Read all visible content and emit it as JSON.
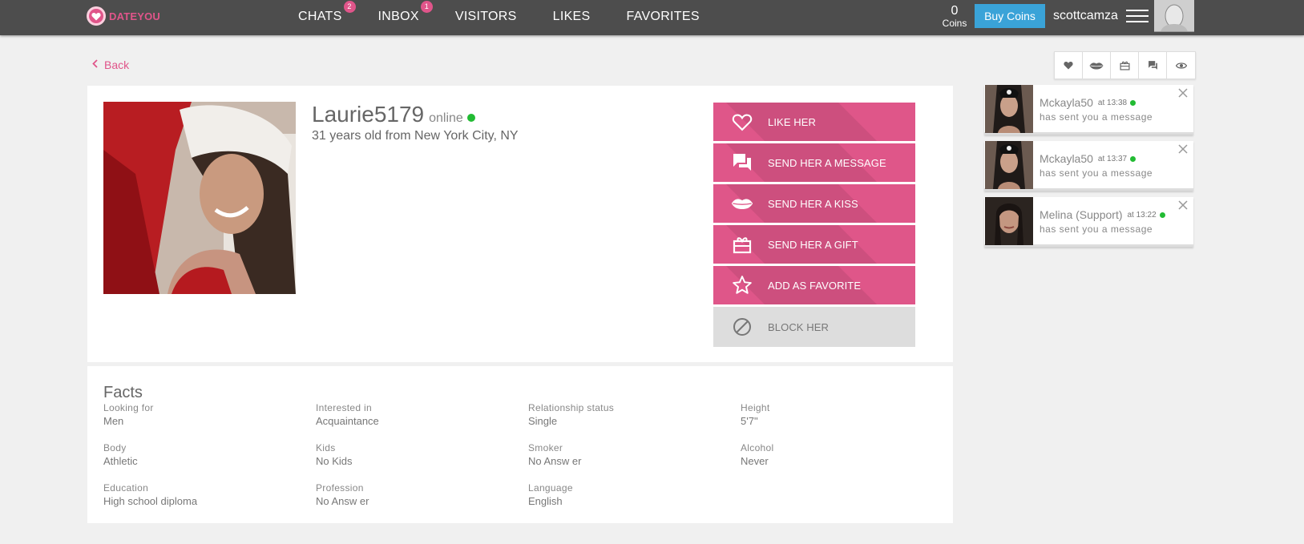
{
  "brand": {
    "name": "DATEYOU",
    "accent": "#e0558a"
  },
  "nav": {
    "items": [
      {
        "label": "CHATS",
        "badge": "2"
      },
      {
        "label": "INBOX",
        "badge": "1"
      },
      {
        "label": "VISITORS",
        "badge": ""
      },
      {
        "label": "LIKES",
        "badge": ""
      },
      {
        "label": "FAVORITES",
        "badge": ""
      }
    ]
  },
  "account": {
    "coins": "0",
    "coins_label": "Coins",
    "buy_label": "Buy Coins",
    "username": "scottcamza"
  },
  "back_label": "Back",
  "icon_strip": [
    "heart-icon",
    "kiss-icon",
    "gift-icon",
    "chat-icon",
    "eye-icon"
  ],
  "profile": {
    "name": "Laurie5179",
    "status": "online",
    "subtitle": "31 years old from New York City, NY"
  },
  "actions": [
    {
      "label": "LIKE HER",
      "icon": "heart-icon"
    },
    {
      "label": "SEND HER A MESSAGE",
      "icon": "message-icon"
    },
    {
      "label": "SEND HER A KISS",
      "icon": "kiss-icon"
    },
    {
      "label": "SEND HER A GIFT",
      "icon": "gift-icon"
    },
    {
      "label": "ADD AS FAVORITE",
      "icon": "star-icon"
    },
    {
      "label": "BLOCK HER",
      "icon": "block-icon"
    }
  ],
  "facts": {
    "title": "Facts",
    "items": [
      {
        "label": "Looking for",
        "value": "Men"
      },
      {
        "label": "Interested in",
        "value": "Acquaintance"
      },
      {
        "label": "Relationship status",
        "value": "Single"
      },
      {
        "label": "Height",
        "value": "5'7\""
      },
      {
        "label": "Body",
        "value": "Athletic"
      },
      {
        "label": "Kids",
        "value": "No Kids"
      },
      {
        "label": "Smoker",
        "value": "No Answ er"
      },
      {
        "label": "Alcohol",
        "value": "Never"
      },
      {
        "label": "Education",
        "value": "High school diploma"
      },
      {
        "label": "Profession",
        "value": "No Answ er"
      },
      {
        "label": "Language",
        "value": "English"
      }
    ]
  },
  "notifications": [
    {
      "name": "Mckayla50",
      "time": "at 13:38",
      "message": "has sent you a message"
    },
    {
      "name": "Mckayla50",
      "time": "at 13:37",
      "message": "has sent you a message"
    },
    {
      "name": "Melina (Support)",
      "time": "at 13:22",
      "message": "has sent you a message"
    }
  ]
}
